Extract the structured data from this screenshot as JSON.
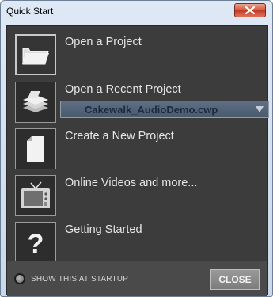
{
  "window": {
    "title": "Quick Start",
    "close_icon": "close-x-icon"
  },
  "items": [
    {
      "label": "Open a Project",
      "icon": "folder-icon"
    },
    {
      "label": "Open a Recent Project",
      "icon": "stacked-papers-icon"
    },
    {
      "label": "Create a New Project",
      "icon": "blank-document-icon"
    },
    {
      "label": "Online Videos and more...",
      "icon": "television-icon"
    },
    {
      "label": "Getting Started",
      "icon": "question-mark-icon"
    }
  ],
  "recent_project": {
    "selected": "Cakewalk_AudioDemo.cwp",
    "arrow_icon": "dropdown-arrow-icon"
  },
  "footer": {
    "startup_label": "SHOW THIS AT STARTUP",
    "close_label": "CLOSE"
  },
  "colors": {
    "panel_background": "#3c3c3c",
    "footer_background": "#4a4a4a",
    "dropdown_background": "#55657a",
    "title_close_red": "#c94a35"
  }
}
